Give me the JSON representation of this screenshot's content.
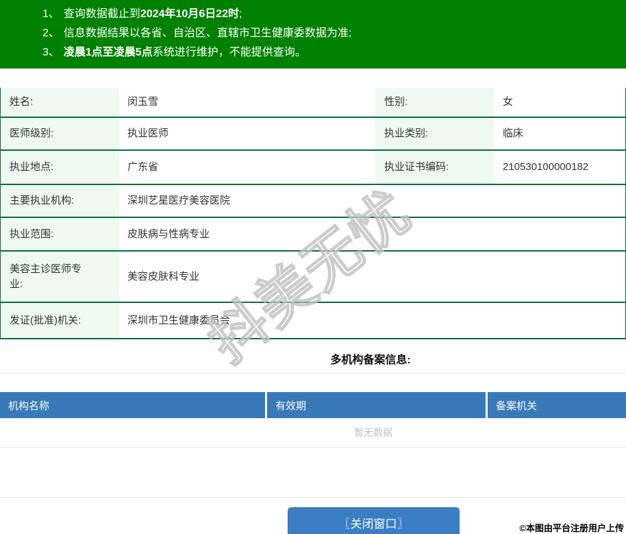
{
  "banner": {
    "items": [
      {
        "num": "1、",
        "pre": "查询数据截止到",
        "bold": "2024年10月6日22时",
        "post": ";"
      },
      {
        "num": "2、",
        "pre": "信息数据结果以各省、自治区、直辖市卫生健康委数据为准;",
        "bold": "",
        "post": ""
      },
      {
        "num": "3、",
        "pre": "",
        "bold": "凌晨1点至凌晨5点",
        "post": "系统进行维护，不能提供查询。"
      }
    ]
  },
  "info": {
    "rows_pair": [
      {
        "l1": "姓名:",
        "v1": "闵玉雪",
        "l2": "性别:",
        "v2": "女"
      },
      {
        "l1": "医师级别:",
        "v1": "执业医师",
        "l2": "执业类别:",
        "v2": "临床"
      },
      {
        "l1": "执业地点:",
        "v1": "广东省",
        "l2": "执业证书编码:",
        "v2": "210530100000182"
      }
    ],
    "rows_single": [
      {
        "label": "主要执业机构:",
        "value": "深圳艺星医疗美容医院"
      },
      {
        "label": "执业范围:",
        "value": "皮肤病与性病专业"
      },
      {
        "label": "美容主诊医师专业:",
        "value": "美容皮肤科专业"
      },
      {
        "label": "发证(批准)机关:",
        "value": "深圳市卫生健康委员会"
      }
    ]
  },
  "filing": {
    "title": "多机构备案信息:",
    "columns": [
      "机构名称",
      "有效期",
      "备案机关"
    ],
    "empty_text": "暂无数据"
  },
  "footer": {
    "close_button": "〖关闭窗口〗",
    "copyright": "©本图由平台注册用户上传"
  },
  "watermark": {
    "text": "抖美无忧"
  },
  "colors": {
    "banner_green": "#008000",
    "table_border_green": "#0e6b3a",
    "label_bg_mint": "#eef9f2",
    "header_blue": "#3879b8",
    "button_blue": "#3b7ec3"
  }
}
